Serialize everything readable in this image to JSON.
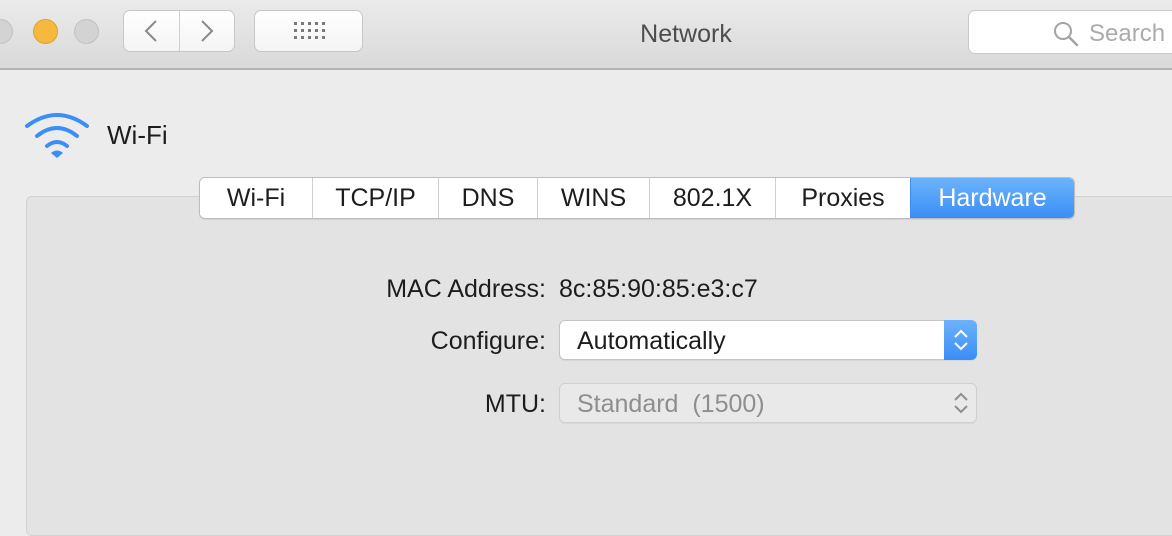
{
  "window": {
    "title": "Network"
  },
  "toolbar": {
    "search_placeholder": "Search",
    "icons": [
      "back-chevron-icon",
      "forward-chevron-icon",
      "grid-icon",
      "search-icon"
    ]
  },
  "service": {
    "name": "Wi-Fi",
    "icon": "wifi-icon"
  },
  "tabs": [
    {
      "label": "Wi-Fi"
    },
    {
      "label": "TCP/IP"
    },
    {
      "label": "DNS"
    },
    {
      "label": "WINS"
    },
    {
      "label": "802.1X"
    },
    {
      "label": "Proxies"
    },
    {
      "label": "Hardware",
      "selected": true
    }
  ],
  "hardware": {
    "mac_label": "MAC Address:",
    "mac_value": "8c:85:90:85:e3:c7",
    "configure_label": "Configure:",
    "configure_value": "Automatically",
    "mtu_label": "MTU:",
    "mtu_value": "Standard  (1500)"
  },
  "colors": {
    "accent": "#3a8ef6",
    "minimize": "#f5b93d",
    "wifi_icon": "#3a8ef6"
  }
}
